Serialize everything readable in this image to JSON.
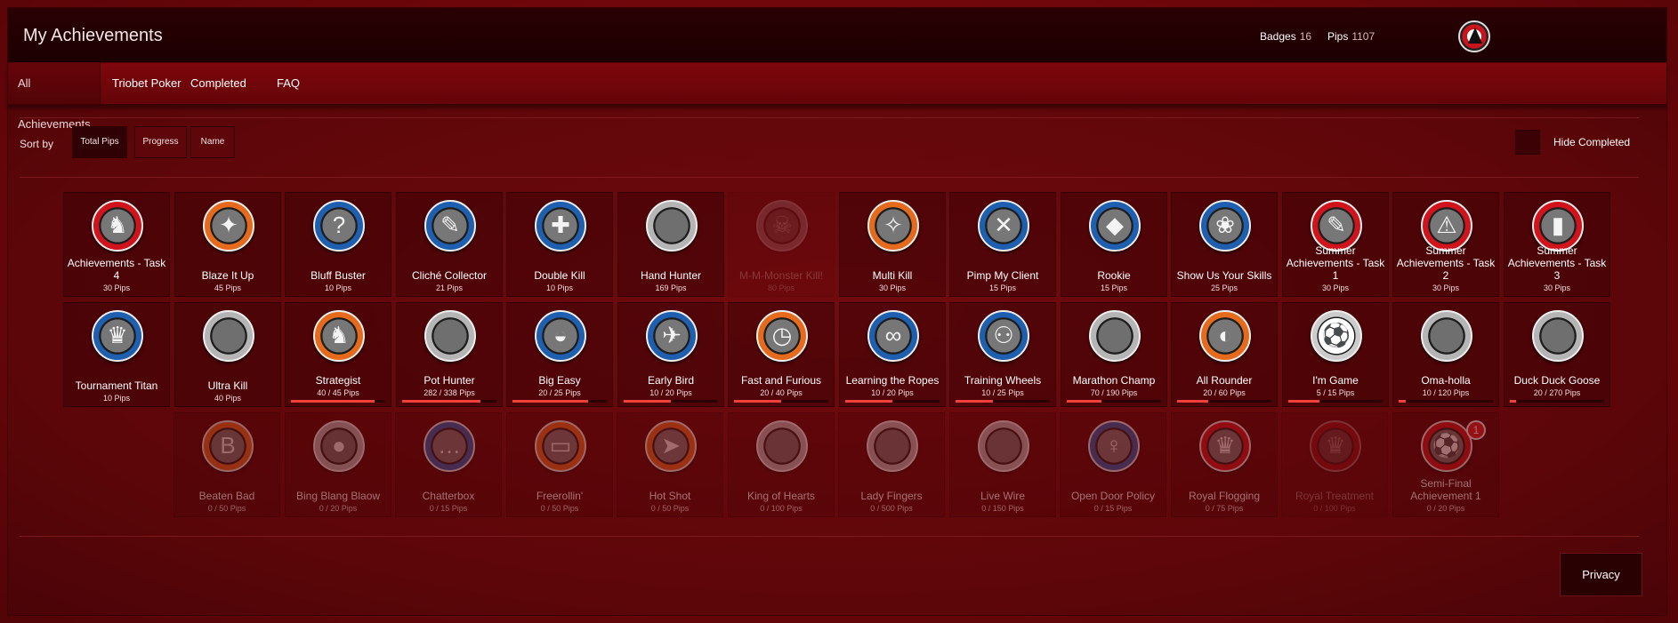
{
  "header": {
    "title": "My Achievements",
    "logo_icon": "triobet-logo-icon",
    "badges_label": "Badges",
    "badges_value": "16",
    "pips_label": "Pips",
    "pips_value": "1107"
  },
  "nav": {
    "tabs": [
      "All Achievements",
      "Triobet Poker",
      "Completed",
      "FAQ"
    ],
    "active": "All Achievements"
  },
  "sort": {
    "label": "Sort by",
    "options": [
      "Total Pips",
      "Progress",
      "Name"
    ],
    "active": "Total Pips",
    "hide_completed_label": "Hide Completed"
  },
  "achievements": [
    {
      "name": "Achievements - Task 4",
      "pips": "30 Pips",
      "icon": "deer-head-icon",
      "color": "red",
      "state": "done"
    },
    {
      "name": "Blaze It Up",
      "pips": "45 Pips",
      "icon": "fire-sign-icon",
      "color": "orange",
      "state": "done"
    },
    {
      "name": "Bluff Buster",
      "pips": "10 Pips",
      "icon": "question-cards-icon",
      "color": "blue",
      "state": "done"
    },
    {
      "name": "Cliché Collector",
      "pips": "21 Pips",
      "icon": "feather-icon",
      "color": "blue",
      "state": "done"
    },
    {
      "name": "Double Kill",
      "pips": "10 Pips",
      "icon": "double-gun-icon",
      "color": "blue",
      "state": "done"
    },
    {
      "name": "Hand Hunter",
      "pips": "169 Pips",
      "icon": "chip-icon",
      "color": "grey",
      "state": "done"
    },
    {
      "name": "M-M-Monster Kill!",
      "pips": "80 Pips",
      "icon": "monster-icon",
      "color": "grey",
      "state": "ghost"
    },
    {
      "name": "Multi Kill",
      "pips": "30 Pips",
      "icon": "revolver-icon",
      "color": "orange",
      "state": "done"
    },
    {
      "name": "Pimp My Client",
      "pips": "15 Pips",
      "icon": "tools-icon",
      "color": "blue",
      "state": "done"
    },
    {
      "name": "Rookie",
      "pips": "15 Pips",
      "icon": "hat-icon",
      "color": "blue",
      "state": "done"
    },
    {
      "name": "Show Us Your Skills",
      "pips": "25 Pips",
      "icon": "fish-icon",
      "color": "blue",
      "state": "done"
    },
    {
      "name": "Summer Achievements - Task 1",
      "pips": "30 Pips",
      "icon": "feather-icon",
      "color": "red",
      "state": "done"
    },
    {
      "name": "Summer Achievements - Task 2",
      "pips": "30 Pips",
      "icon": "warning-sign-icon",
      "color": "red",
      "state": "done"
    },
    {
      "name": "Summer Achievements - Task 3",
      "pips": "30 Pips",
      "icon": "bottles-icon",
      "color": "red",
      "state": "done"
    },
    {
      "name": "Tournament Titan",
      "pips": "10 Pips",
      "icon": "trophy-icon",
      "color": "blue",
      "state": "done"
    },
    {
      "name": "Ultra Kill",
      "pips": "40 Pips",
      "icon": "chip-icon",
      "color": "grey",
      "state": "done"
    },
    {
      "name": "Strategist",
      "pips": "40 / 45 Pips",
      "icon": "chess-knight-icon",
      "color": "orange",
      "state": "progress",
      "progress": 0.89
    },
    {
      "name": "Pot Hunter",
      "pips": "282 / 338 Pips",
      "icon": "chip-icon",
      "color": "grey",
      "state": "progress",
      "progress": 0.83
    },
    {
      "name": "Big Easy",
      "pips": "20 / 25 Pips",
      "icon": "fedora-icon",
      "color": "blue",
      "state": "progress",
      "progress": 0.8
    },
    {
      "name": "Early Bird",
      "pips": "10 / 20 Pips",
      "icon": "bird-icon",
      "color": "blue",
      "state": "progress",
      "progress": 0.5
    },
    {
      "name": "Fast and Furious",
      "pips": "20 / 40 Pips",
      "icon": "stopwatch-icon",
      "color": "orange",
      "state": "progress",
      "progress": 0.5
    },
    {
      "name": "Learning the Ropes",
      "pips": "10 / 20 Pips",
      "icon": "rope-icon",
      "color": "blue",
      "state": "progress",
      "progress": 0.5
    },
    {
      "name": "Training Wheels",
      "pips": "10 / 25 Pips",
      "icon": "bicycle-icon",
      "color": "blue",
      "state": "progress",
      "progress": 0.4
    },
    {
      "name": "Marathon Champ",
      "pips": "70 / 190 Pips",
      "icon": "chip-icon",
      "color": "grey",
      "state": "progress",
      "progress": 0.37
    },
    {
      "name": "All Rounder",
      "pips": "20 / 60 Pips",
      "icon": "moon-icon",
      "color": "orange",
      "state": "progress",
      "progress": 0.33
    },
    {
      "name": "I'm Game",
      "pips": "5 / 15 Pips",
      "icon": "soccer-ball-icon",
      "color": "white",
      "state": "progress",
      "progress": 0.33
    },
    {
      "name": "Oma-holla",
      "pips": "10 / 120 Pips",
      "icon": "chip-icon",
      "color": "grey",
      "state": "progress",
      "progress": 0.08
    },
    {
      "name": "Duck Duck Goose",
      "pips": "20 / 270 Pips",
      "icon": "chip-icon",
      "color": "grey",
      "state": "progress",
      "progress": 0.07
    },
    {
      "name": "Beaten Bad",
      "pips": "0 / 50 Pips",
      "icon": "bb-element-icon",
      "color": "orange",
      "state": "locked"
    },
    {
      "name": "Bing Blang Blaow",
      "pips": "0 / 20 Pips",
      "icon": "brass-knuckles-icon",
      "color": "grey",
      "state": "locked"
    },
    {
      "name": "Chatterbox",
      "pips": "0 / 15 Pips",
      "icon": "speech-bubble-icon",
      "color": "blue",
      "state": "locked"
    },
    {
      "name": "Freerollin'",
      "pips": "0 / 50 Pips",
      "icon": "ticket-icon",
      "color": "orange",
      "state": "locked"
    },
    {
      "name": "Hot Shot",
      "pips": "0 / 50 Pips",
      "icon": "cannon-icon",
      "color": "orange",
      "state": "locked"
    },
    {
      "name": "King of Hearts",
      "pips": "0 / 100 Pips",
      "icon": "chip-icon",
      "color": "grey",
      "state": "locked"
    },
    {
      "name": "Lady Fingers",
      "pips": "0 / 500 Pips",
      "icon": "chip-icon",
      "color": "grey",
      "state": "locked"
    },
    {
      "name": "Live Wire",
      "pips": "0 / 150 Pips",
      "icon": "chip-icon",
      "color": "grey",
      "state": "locked"
    },
    {
      "name": "Open Door Policy",
      "pips": "0 / 15 Pips",
      "icon": "figure-icon",
      "color": "blue",
      "state": "locked"
    },
    {
      "name": "Royal Flogging",
      "pips": "0 / 75 Pips",
      "icon": "crown-icon",
      "color": "red",
      "state": "locked"
    },
    {
      "name": "Royal Treatment",
      "pips": "0 / 100 Pips",
      "icon": "crown-icon",
      "color": "red",
      "state": "ghost"
    },
    {
      "name": "Semi-Final Achievement 1",
      "pips": "0 / 20 Pips",
      "icon": "soccer-ball-icon",
      "color": "red",
      "state": "locked",
      "badge": "1"
    }
  ],
  "footer": {
    "privacy_label": "Privacy"
  }
}
